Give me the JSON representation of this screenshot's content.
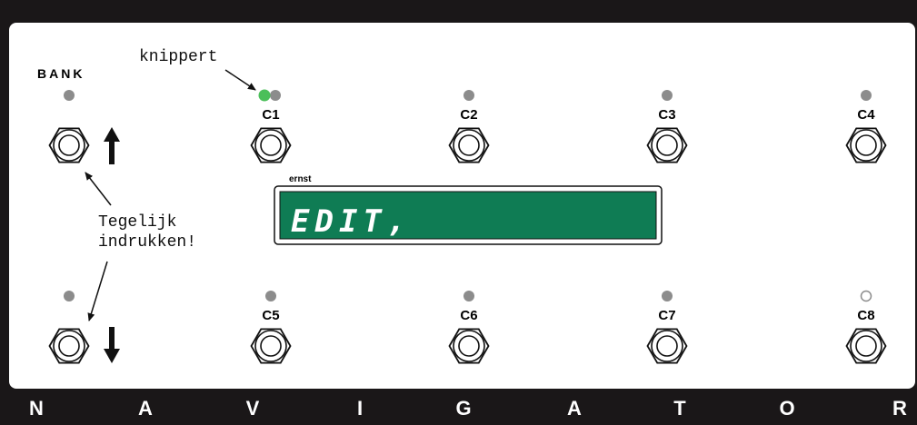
{
  "bank": {
    "label": "BANK"
  },
  "annotations": {
    "blink": "knippert",
    "press_line1": "Tegelijk",
    "press_line2": "indrukken!"
  },
  "display": {
    "owner": "ernst",
    "text": "EDIT,"
  },
  "channels": [
    {
      "label": "C1",
      "led": "green-blinking"
    },
    {
      "label": "C2",
      "led": "off"
    },
    {
      "label": "C3",
      "led": "off"
    },
    {
      "label": "C4",
      "led": "off"
    },
    {
      "label": "C5",
      "led": "off"
    },
    {
      "label": "C6",
      "led": "off"
    },
    {
      "label": "C7",
      "led": "off"
    },
    {
      "label": "C8",
      "led": "hollow"
    }
  ],
  "brand_letters": [
    "N",
    "A",
    "V",
    "I",
    "G",
    "A",
    "T",
    "O",
    "R"
  ],
  "colors": {
    "frame": "#1a1718",
    "led_gray": "#8c8c8c",
    "led_green": "#4bbf5a",
    "lcd": "#0f7c54"
  }
}
